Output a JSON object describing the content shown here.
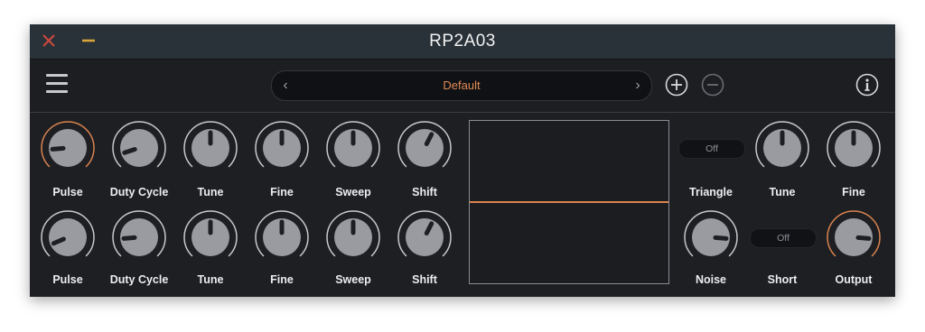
{
  "window": {
    "title": "RP2A03",
    "close_icon": "close-x-icon",
    "minimize_icon": "minimize-icon"
  },
  "toolbar": {
    "menu_icon": "hamburger-menu-icon",
    "preset_prev_icon": "chevron-left-icon",
    "preset_next_icon": "chevron-right-icon",
    "preset_name": "Default",
    "prev_glyph": "‹",
    "next_glyph": "›",
    "add_icon": "plus-circle-icon",
    "remove_icon": "minus-circle-icon",
    "info_icon": "info-icon"
  },
  "pulse1": {
    "knobs": [
      {
        "label": "Pulse",
        "value": 0.15,
        "active": true
      },
      {
        "label": "Duty Cycle",
        "value": 0.1,
        "active": false
      },
      {
        "label": "Tune",
        "value": 0.5,
        "active": false
      },
      {
        "label": "Fine",
        "value": 0.5,
        "active": false
      },
      {
        "label": "Sweep",
        "value": 0.5,
        "active": false
      },
      {
        "label": "Shift",
        "value": 0.6,
        "active": false
      }
    ]
  },
  "pulse2": {
    "knobs": [
      {
        "label": "Pulse",
        "value": 0.08,
        "active": false
      },
      {
        "label": "Duty Cycle",
        "value": 0.15,
        "active": false
      },
      {
        "label": "Tune",
        "value": 0.5,
        "active": false
      },
      {
        "label": "Fine",
        "value": 0.5,
        "active": false
      },
      {
        "label": "Sweep",
        "value": 0.5,
        "active": false
      },
      {
        "label": "Shift",
        "value": 0.6,
        "active": false
      }
    ]
  },
  "triangle": {
    "toggle": "Off",
    "label": "Triangle",
    "tune": {
      "label": "Tune",
      "value": 0.5
    },
    "fine": {
      "label": "Fine",
      "value": 0.5
    }
  },
  "noise": {
    "knob": {
      "label": "Noise",
      "value": 0.85
    },
    "short_toggle": "Off",
    "short_label": "Short",
    "output": {
      "label": "Output",
      "value": 0.85,
      "active": true
    }
  },
  "scope": {
    "level": 0.0
  },
  "colors": {
    "accent": "#d9834e",
    "title_bar": "#283238",
    "panel": "#1e1f23",
    "knob_body": "#9a9ba1",
    "knob_ring": "#c8c9cc"
  }
}
